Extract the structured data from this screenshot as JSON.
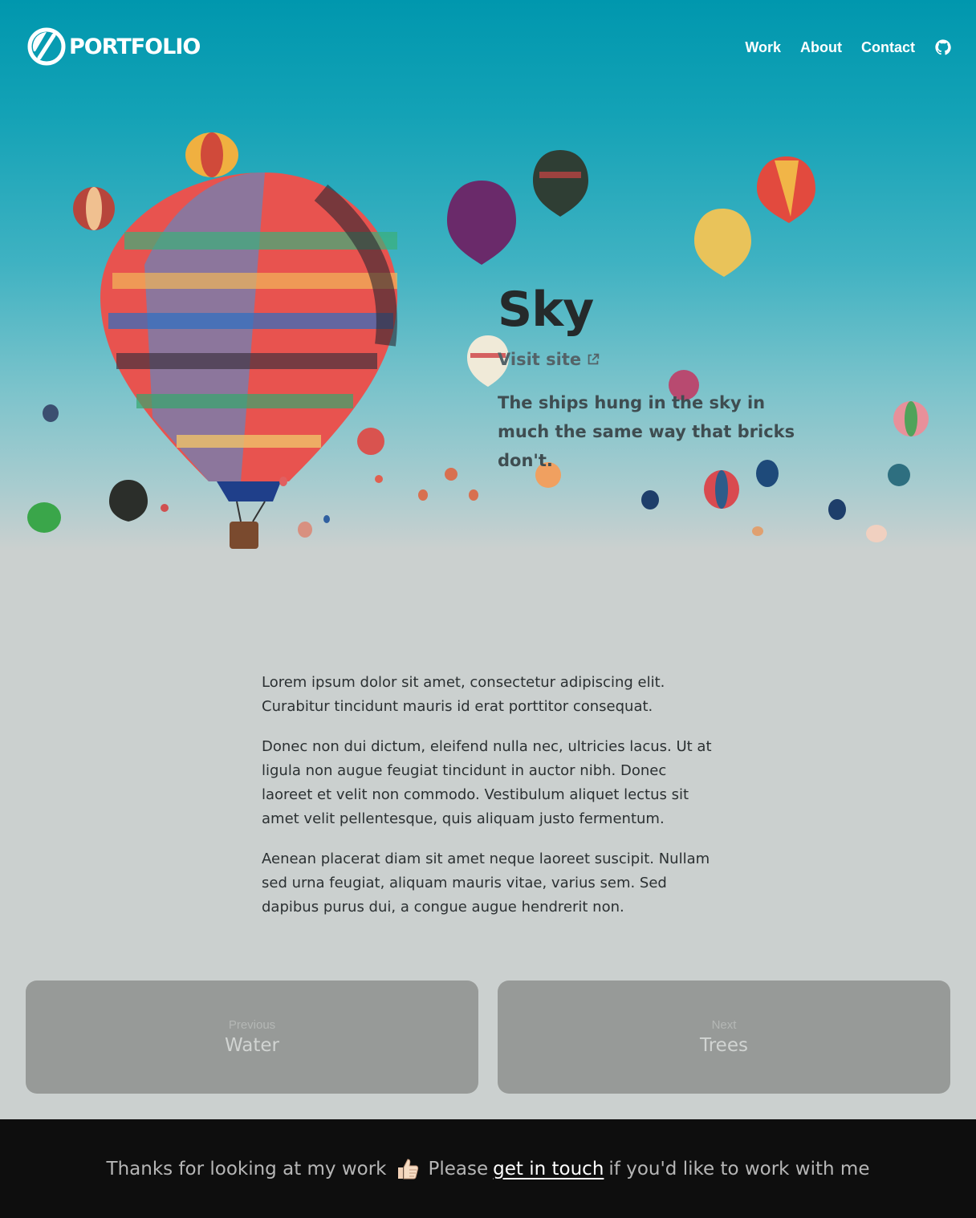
{
  "brand": {
    "logo_text": "PORTFOLIO"
  },
  "nav": {
    "items": [
      {
        "label": "Work"
      },
      {
        "label": "About"
      },
      {
        "label": "Contact"
      }
    ],
    "github_icon": "github-icon"
  },
  "hero": {
    "title": "Sky",
    "visit_label": "Visit site",
    "visit_icon": "external-link-icon",
    "tagline": "The ships hung in the sky in much the same way that bricks don't."
  },
  "content": {
    "paragraphs": [
      "Lorem ipsum dolor sit amet, consectetur adipiscing elit. Curabitur tincidunt mauris id erat porttitor consequat.",
      "Donec non dui dictum, eleifend nulla nec, ultricies lacus. Ut at ligula non augue feugiat tincidunt in auctor nibh. Donec laoreet et velit non commodo. Vestibulum aliquet lectus sit amet velit pellentesque, quis aliquam justo fermentum.",
      "Aenean placerat diam sit amet neque laoreet suscipit. Nullam sed urna feugiat, aliquam mauris vitae, varius sem. Sed dapibus purus dui, a congue augue hendrerit non."
    ]
  },
  "pager": {
    "previous": {
      "kicker": "Previous",
      "title": "Water"
    },
    "next": {
      "kicker": "Next",
      "title": "Trees"
    }
  },
  "footer": {
    "text_before": "Thanks for looking at my work",
    "thumb_icon": "thumbs-up-icon",
    "text_please": "Please",
    "link_label": "get in touch",
    "text_after": "if you'd like to work with me"
  },
  "colors": {
    "sky_top": "#0097ae",
    "haze": "#cbd0cf",
    "card": "#979a98",
    "footer_bg": "#0e0e0e"
  }
}
